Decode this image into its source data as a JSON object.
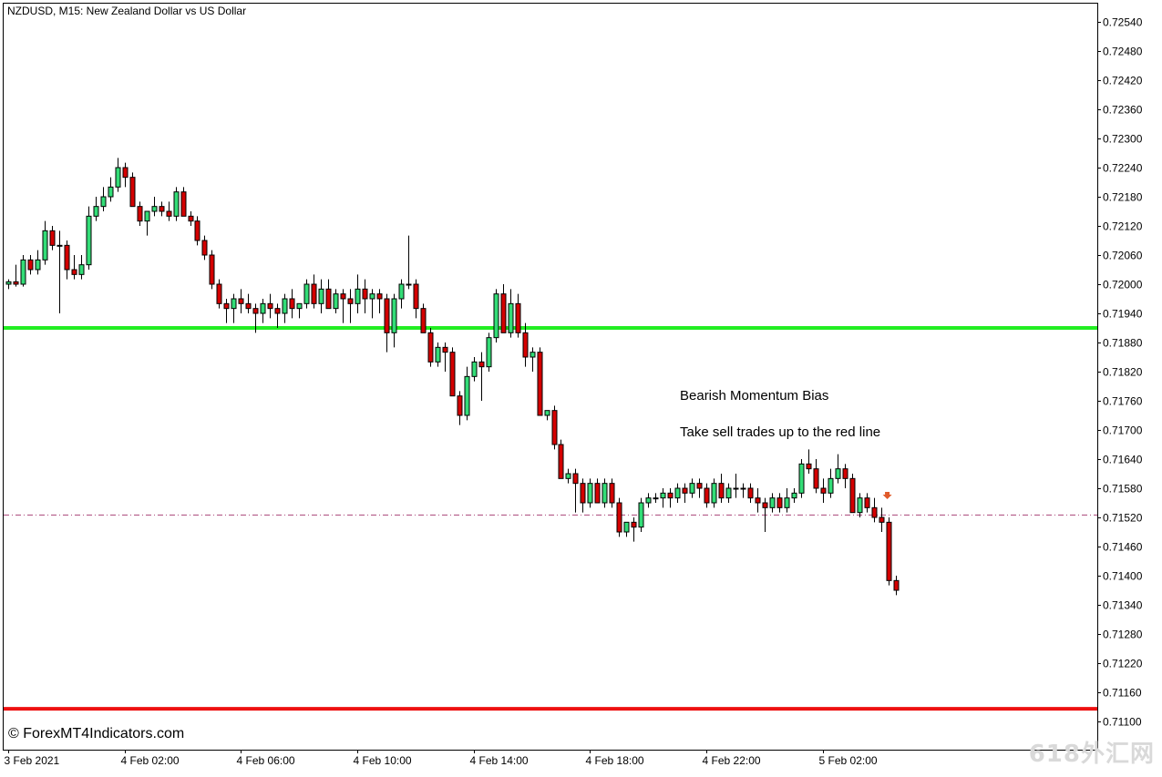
{
  "header": {
    "title": "NZDUSD, M15:  New Zealand Dollar vs US Dollar"
  },
  "annotations": {
    "line1": "Bearish Momentum Bias",
    "line2": "Take sell trades up to the red line"
  },
  "copyright": "© ForexMT4Indicators.com",
  "watermark": "618外汇网",
  "colors": {
    "bull": "#33dd77",
    "bear": "#d40000",
    "wick": "#000000",
    "green_line": "#22ee22",
    "red_line": "#ee1111",
    "current_line": "#aa4477",
    "arrow": "#e05a2a"
  },
  "chart_data": {
    "type": "candlestick",
    "symbol": "NZDUSD",
    "timeframe": "M15",
    "ylim": [
      0.7107,
      0.7256
    ],
    "y_ticks": [
      "0.72540",
      "0.72480",
      "0.72420",
      "0.72360",
      "0.72300",
      "0.72240",
      "0.72180",
      "0.72120",
      "0.72060",
      "0.72000",
      "0.71940",
      "0.71880",
      "0.71820",
      "0.71760",
      "0.71700",
      "0.71640",
      "0.71580",
      "0.71520",
      "0.71460",
      "0.71400",
      "0.71340",
      "0.71280",
      "0.71220",
      "0.71160",
      "0.71100"
    ],
    "x_labels": [
      {
        "label": "3 Feb 2021",
        "index": 0
      },
      {
        "label": "4 Feb 02:00",
        "index": 16
      },
      {
        "label": "4 Feb 06:00",
        "index": 32
      },
      {
        "label": "4 Feb 10:00",
        "index": 48
      },
      {
        "label": "4 Feb 14:00",
        "index": 64
      },
      {
        "label": "4 Feb 18:00",
        "index": 80
      },
      {
        "label": "4 Feb 22:00",
        "index": 96
      },
      {
        "label": "5 Feb 02:00",
        "index": 112
      }
    ],
    "support_level": 0.7191,
    "target_level": 0.71126,
    "current_price_level": 0.71525,
    "sell_arrow_index": 121,
    "candles": [
      [
        0.72,
        0.7201,
        0.7199,
        0.72005
      ],
      [
        0.72005,
        0.7204,
        0.71995,
        0.72
      ],
      [
        0.72,
        0.7206,
        0.71995,
        0.7205
      ],
      [
        0.7205,
        0.7206,
        0.7202,
        0.7203
      ],
      [
        0.7203,
        0.7207,
        0.7202,
        0.7205
      ],
      [
        0.7205,
        0.7213,
        0.7204,
        0.7211
      ],
      [
        0.7211,
        0.7212,
        0.7207,
        0.7208
      ],
      [
        0.7208,
        0.7211,
        0.7194,
        0.7208
      ],
      [
        0.7208,
        0.7209,
        0.7201,
        0.7203
      ],
      [
        0.7203,
        0.7206,
        0.7201,
        0.7202
      ],
      [
        0.7202,
        0.7206,
        0.7201,
        0.7204
      ],
      [
        0.7204,
        0.7216,
        0.7203,
        0.7214
      ],
      [
        0.7214,
        0.7218,
        0.7213,
        0.7216
      ],
      [
        0.7216,
        0.722,
        0.7215,
        0.7218
      ],
      [
        0.7218,
        0.7222,
        0.7217,
        0.722
      ],
      [
        0.722,
        0.7226,
        0.7219,
        0.7224
      ],
      [
        0.7224,
        0.7225,
        0.722,
        0.7222
      ],
      [
        0.7222,
        0.7223,
        0.7216,
        0.7216
      ],
      [
        0.7216,
        0.7217,
        0.7212,
        0.7213
      ],
      [
        0.7213,
        0.7215,
        0.721,
        0.7215
      ],
      [
        0.7215,
        0.7218,
        0.7214,
        0.7216
      ],
      [
        0.7216,
        0.7217,
        0.7214,
        0.7215
      ],
      [
        0.7215,
        0.7217,
        0.7213,
        0.7214
      ],
      [
        0.7214,
        0.722,
        0.7213,
        0.7219
      ],
      [
        0.7219,
        0.722,
        0.7214,
        0.7214
      ],
      [
        0.7214,
        0.7215,
        0.7212,
        0.7213
      ],
      [
        0.7213,
        0.7214,
        0.7208,
        0.7209
      ],
      [
        0.7209,
        0.721,
        0.7205,
        0.7206
      ],
      [
        0.7206,
        0.7207,
        0.7199,
        0.72
      ],
      [
        0.72,
        0.7201,
        0.7195,
        0.7196
      ],
      [
        0.7196,
        0.7197,
        0.7192,
        0.7195
      ],
      [
        0.7195,
        0.7198,
        0.7192,
        0.7197
      ],
      [
        0.7197,
        0.7199,
        0.7194,
        0.7196
      ],
      [
        0.7196,
        0.7198,
        0.7194,
        0.7195
      ],
      [
        0.7195,
        0.7196,
        0.719,
        0.7194
      ],
      [
        0.7194,
        0.7197,
        0.7192,
        0.7196
      ],
      [
        0.7196,
        0.7198,
        0.7193,
        0.7195
      ],
      [
        0.7195,
        0.7196,
        0.7191,
        0.7194
      ],
      [
        0.7194,
        0.7198,
        0.7192,
        0.7197
      ],
      [
        0.7197,
        0.7199,
        0.7193,
        0.7195
      ],
      [
        0.7195,
        0.7196,
        0.7193,
        0.7196
      ],
      [
        0.7196,
        0.7201,
        0.7195,
        0.72
      ],
      [
        0.72,
        0.7202,
        0.7195,
        0.7196
      ],
      [
        0.7196,
        0.7201,
        0.7194,
        0.7199
      ],
      [
        0.7199,
        0.7201,
        0.7195,
        0.7195
      ],
      [
        0.7195,
        0.7199,
        0.7194,
        0.7198
      ],
      [
        0.7198,
        0.7199,
        0.7192,
        0.7197
      ],
      [
        0.7197,
        0.7199,
        0.7192,
        0.7196
      ],
      [
        0.7196,
        0.7202,
        0.7194,
        0.7199
      ],
      [
        0.7199,
        0.7201,
        0.7194,
        0.7197
      ],
      [
        0.7197,
        0.7199,
        0.7193,
        0.7198
      ],
      [
        0.7198,
        0.7199,
        0.7194,
        0.7197
      ],
      [
        0.7197,
        0.7198,
        0.7186,
        0.719
      ],
      [
        0.719,
        0.7198,
        0.7187,
        0.7197
      ],
      [
        0.7197,
        0.7201,
        0.7195,
        0.72
      ],
      [
        0.72,
        0.721,
        0.7199,
        0.72
      ],
      [
        0.72,
        0.7201,
        0.7193,
        0.7195
      ],
      [
        0.7195,
        0.7196,
        0.719,
        0.719
      ],
      [
        0.719,
        0.7191,
        0.7183,
        0.7184
      ],
      [
        0.7184,
        0.7188,
        0.7183,
        0.7187
      ],
      [
        0.7187,
        0.7188,
        0.7182,
        0.7186
      ],
      [
        0.7186,
        0.7187,
        0.7177,
        0.7177
      ],
      [
        0.7177,
        0.7178,
        0.7171,
        0.7173
      ],
      [
        0.7173,
        0.7183,
        0.7172,
        0.7181
      ],
      [
        0.7181,
        0.7185,
        0.718,
        0.7184
      ],
      [
        0.7184,
        0.7186,
        0.7176,
        0.7183
      ],
      [
        0.7183,
        0.719,
        0.7182,
        0.7189
      ],
      [
        0.7189,
        0.7199,
        0.7188,
        0.7198
      ],
      [
        0.7198,
        0.72,
        0.7191,
        0.719
      ],
      [
        0.719,
        0.7199,
        0.7189,
        0.7196
      ],
      [
        0.7196,
        0.7198,
        0.7189,
        0.719
      ],
      [
        0.719,
        0.7192,
        0.7183,
        0.7185
      ],
      [
        0.7185,
        0.7187,
        0.7182,
        0.7186
      ],
      [
        0.7186,
        0.7187,
        0.7173,
        0.7173
      ],
      [
        0.7173,
        0.7174,
        0.7172,
        0.7174
      ],
      [
        0.7174,
        0.7175,
        0.7166,
        0.7167
      ],
      [
        0.7167,
        0.7168,
        0.716,
        0.716
      ],
      [
        0.716,
        0.7162,
        0.7159,
        0.7161
      ],
      [
        0.7161,
        0.7162,
        0.7153,
        0.7159
      ],
      [
        0.7159,
        0.716,
        0.7153,
        0.7155
      ],
      [
        0.7155,
        0.716,
        0.7154,
        0.7159
      ],
      [
        0.7159,
        0.716,
        0.7155,
        0.7155
      ],
      [
        0.7155,
        0.716,
        0.7154,
        0.7159
      ],
      [
        0.7159,
        0.716,
        0.7154,
        0.7155
      ],
      [
        0.7155,
        0.7156,
        0.7148,
        0.7149
      ],
      [
        0.7149,
        0.7151,
        0.7148,
        0.7151
      ],
      [
        0.7151,
        0.7152,
        0.7147,
        0.715
      ],
      [
        0.715,
        0.7156,
        0.7149,
        0.7155
      ],
      [
        0.7155,
        0.7157,
        0.7154,
        0.7156
      ],
      [
        0.7156,
        0.7157,
        0.7155,
        0.7156
      ],
      [
        0.7156,
        0.7158,
        0.7154,
        0.7157
      ],
      [
        0.7157,
        0.7158,
        0.7154,
        0.7156
      ],
      [
        0.7156,
        0.7159,
        0.7155,
        0.7158
      ],
      [
        0.7158,
        0.7159,
        0.7155,
        0.7157
      ],
      [
        0.7157,
        0.716,
        0.7156,
        0.7159
      ],
      [
        0.7159,
        0.716,
        0.7156,
        0.7158
      ],
      [
        0.7158,
        0.7159,
        0.7154,
        0.7155
      ],
      [
        0.7155,
        0.716,
        0.7154,
        0.7159
      ],
      [
        0.7159,
        0.7161,
        0.7155,
        0.7156
      ],
      [
        0.7156,
        0.7159,
        0.7155,
        0.7158
      ],
      [
        0.7158,
        0.7161,
        0.7156,
        0.7158
      ],
      [
        0.7158,
        0.7159,
        0.7156,
        0.7158
      ],
      [
        0.7158,
        0.7159,
        0.7155,
        0.7156
      ],
      [
        0.7156,
        0.7158,
        0.7153,
        0.7155
      ],
      [
        0.7155,
        0.7156,
        0.7149,
        0.7154
      ],
      [
        0.7154,
        0.7157,
        0.7153,
        0.7156
      ],
      [
        0.7156,
        0.7157,
        0.7153,
        0.7154
      ],
      [
        0.7154,
        0.7158,
        0.7153,
        0.7156
      ],
      [
        0.7156,
        0.7158,
        0.7155,
        0.7157
      ],
      [
        0.7157,
        0.7164,
        0.7156,
        0.7163
      ],
      [
        0.7163,
        0.7166,
        0.7161,
        0.7162
      ],
      [
        0.7162,
        0.7164,
        0.7157,
        0.7158
      ],
      [
        0.7158,
        0.716,
        0.7155,
        0.7157
      ],
      [
        0.7157,
        0.7162,
        0.7156,
        0.716
      ],
      [
        0.716,
        0.7165,
        0.7159,
        0.7162
      ],
      [
        0.7162,
        0.7163,
        0.7158,
        0.716
      ],
      [
        0.716,
        0.7161,
        0.7153,
        0.7153
      ],
      [
        0.7153,
        0.7157,
        0.7152,
        0.7156
      ],
      [
        0.7156,
        0.7157,
        0.7153,
        0.7154
      ],
      [
        0.7154,
        0.7156,
        0.7151,
        0.7152
      ],
      [
        0.7152,
        0.7154,
        0.7149,
        0.7151
      ],
      [
        0.7151,
        0.7152,
        0.7138,
        0.7139
      ],
      [
        0.7139,
        0.714,
        0.7136,
        0.7137
      ]
    ]
  }
}
